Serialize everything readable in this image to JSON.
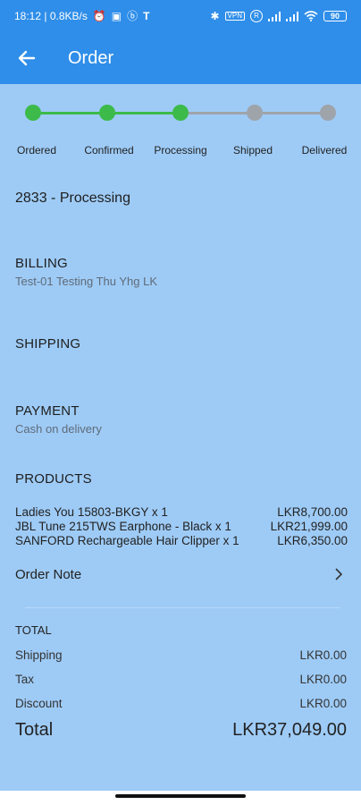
{
  "status_bar": {
    "left_text": "18:12 | 0.8KB/s",
    "right_icons": [
      "bluetooth-icon",
      "vpn-icon",
      "r-icon",
      "signal-icon",
      "signal-icon",
      "wifi-icon",
      "battery-icon"
    ],
    "battery_level": "90",
    "vpn_label": "VPN",
    "r_label": "R"
  },
  "app_bar": {
    "title": "Order"
  },
  "stepper": {
    "steps": [
      {
        "label": "Ordered",
        "done": true
      },
      {
        "label": "Confirmed",
        "done": true
      },
      {
        "label": "Processing",
        "done": true
      },
      {
        "label": "Shipped",
        "done": false
      },
      {
        "label": "Delivered",
        "done": false
      }
    ],
    "colors": {
      "done": "#3cba4a",
      "pending": "#9ea4aa"
    }
  },
  "order": {
    "id_status": "2833 - Processing"
  },
  "billing": {
    "title": "BILLING",
    "value": "Test-01 Testing Thu  Yhg LK"
  },
  "shipping": {
    "title": "SHIPPING"
  },
  "payment": {
    "title": "PAYMENT",
    "value": "Cash on delivery"
  },
  "products": {
    "title": "PRODUCTS",
    "items": [
      {
        "name": "Ladies You 15803-BKGY x 1",
        "price": "LKR8,700.00"
      },
      {
        "name": "JBL Tune 215TWS Earphone - Black x 1",
        "price": "LKR21,999.00"
      },
      {
        "name": "SANFORD Rechargeable Hair Clipper x 1",
        "price": "LKR6,350.00"
      }
    ]
  },
  "order_note": {
    "label": "Order Note"
  },
  "totals": {
    "heading": "TOTAL",
    "rows": [
      {
        "label": "Shipping",
        "value": "LKR0.00"
      },
      {
        "label": "Tax",
        "value": "LKR0.00"
      },
      {
        "label": "Discount",
        "value": "LKR0.00"
      }
    ],
    "grand_label": "Total",
    "grand_value": "LKR37,049.00"
  }
}
